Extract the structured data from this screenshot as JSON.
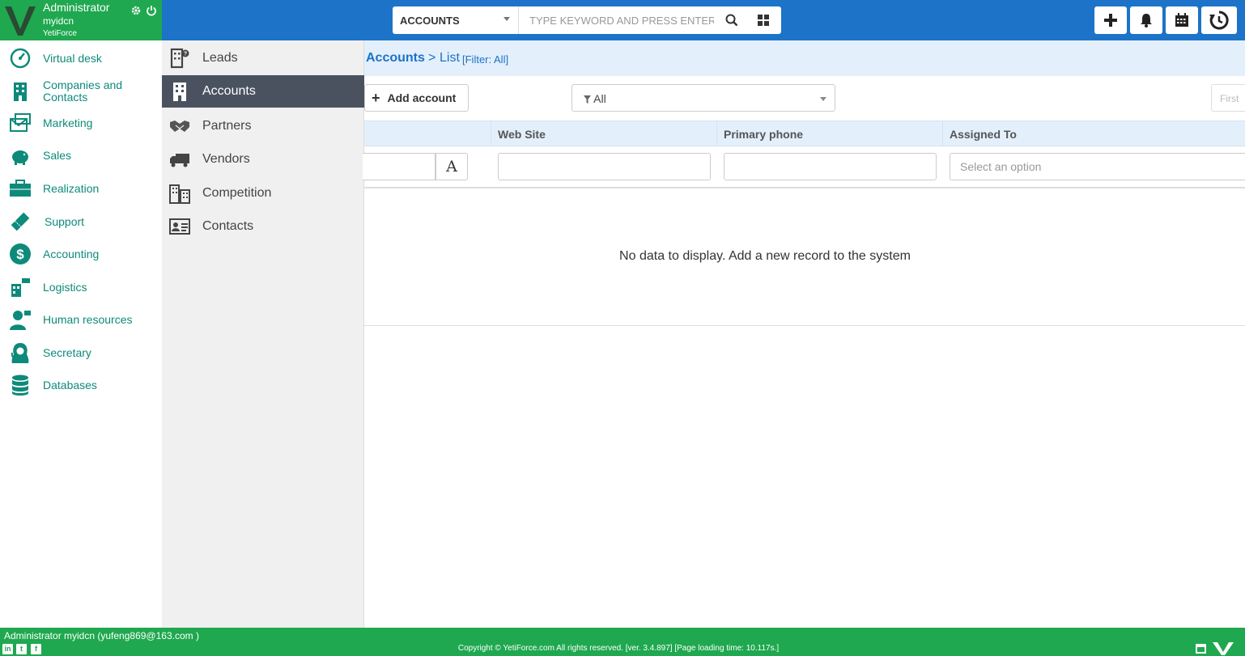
{
  "user": {
    "name": "Administrator",
    "login": "myidcn",
    "org": "YetiForce"
  },
  "search": {
    "module": "ACCOUNTS",
    "placeholder": "TYPE KEYWORD AND PRESS ENTER"
  },
  "sidebar": {
    "items": [
      {
        "label": "Virtual desk",
        "icon": "speedometer-icon"
      },
      {
        "label": "Companies and Contacts",
        "icon": "building-icon"
      },
      {
        "label": "Marketing",
        "icon": "envelopes-icon"
      },
      {
        "label": "Sales",
        "icon": "piggy-bank-icon"
      },
      {
        "label": "Realization",
        "icon": "briefcase-icon"
      },
      {
        "label": "Support",
        "icon": "ticket-icon"
      },
      {
        "label": "Accounting",
        "icon": "dollar-icon"
      },
      {
        "label": "Logistics",
        "icon": "logistics-icon"
      },
      {
        "label": "Human resources",
        "icon": "person-icon"
      },
      {
        "label": "Secretary",
        "icon": "secretary-icon"
      },
      {
        "label": "Databases",
        "icon": "database-icon"
      }
    ]
  },
  "submenu": {
    "items": [
      {
        "label": "Leads",
        "icon": "leads-icon"
      },
      {
        "label": "Accounts",
        "icon": "accounts-icon"
      },
      {
        "label": "Partners",
        "icon": "handshake-icon"
      },
      {
        "label": "Vendors",
        "icon": "truck-icon"
      },
      {
        "label": "Competition",
        "icon": "competition-icon"
      },
      {
        "label": "Contacts",
        "icon": "contact-card-icon"
      }
    ],
    "active": "Accounts"
  },
  "breadcrumb": {
    "module": "Accounts",
    "separator": ">",
    "view": "List",
    "filter": "[Filter: All]"
  },
  "toolbar": {
    "add_label": "Add account",
    "filter_value": "All",
    "first_label": "First"
  },
  "table": {
    "columns": [
      "Web Site",
      "Primary phone",
      "Assigned To"
    ],
    "assigned_placeholder": "Select an option",
    "alpha_button": "A",
    "empty_message": "No data to display. Add a new record to the system"
  },
  "footer": {
    "user_info": "Administrator myidcn (yufeng869@163.com )",
    "copyright": "Copyright © YetiForce.com All rights reserved. [ver. 3.4.897] [Page loading time: 10.117s.]",
    "social": [
      "in",
      "t",
      "f"
    ]
  },
  "colors": {
    "green": "#1fa84f",
    "blue": "#1c73c8",
    "teal": "#0d8a7a",
    "active_sub": "#4a5260"
  }
}
